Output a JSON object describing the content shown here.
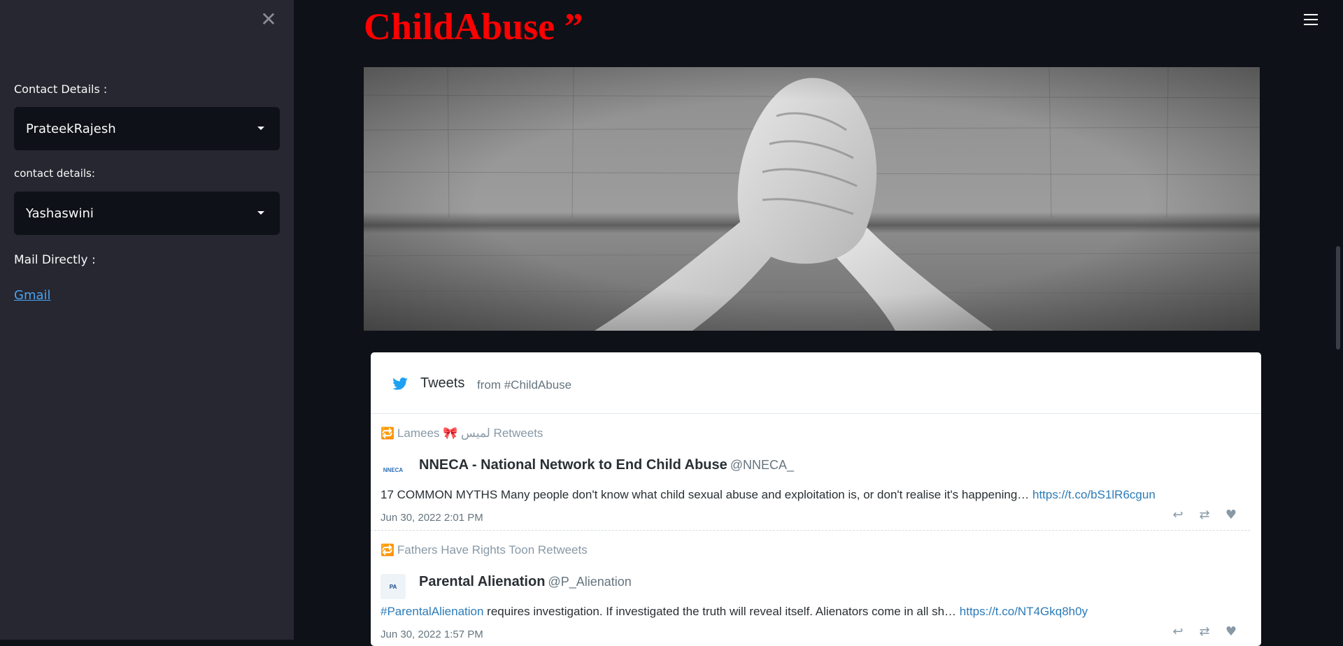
{
  "sidebar": {
    "close_icon": "close-icon",
    "contact_label": "Contact Details :",
    "contact_select_value": "PrateekRajesh",
    "contact2_label": "contact details:",
    "contact2_select_value": "Yashaswini",
    "mail_label": "Mail Directly :",
    "gmail_link": "Gmail"
  },
  "main": {
    "title": "ChildAbuse ”",
    "menu_icon": "hamburger-menu-icon",
    "hero_image": "clasped-hands-photo"
  },
  "tweets_widget": {
    "title": "Tweets",
    "subtitle": "from #ChildAbuse",
    "items": [
      {
        "retweet_line": "Lamees 🎀 لميس Retweets",
        "avatar_text": "NNECA",
        "name": "NNECA - National Network to End Child Abuse",
        "handle": "@NNECA_",
        "text": "17 COMMON MYTHS Many people don't know what child sexual abuse and exploitation is, or don't realise it's happening… ",
        "link": "https://t.co/bS1lR6cgun",
        "time": "Jun 30, 2022 2:01 PM"
      },
      {
        "retweet_line": "Fathers Have Rights Toon Retweets",
        "avatar_text": "PA",
        "name": "Parental Alienation",
        "handle": "@P_Alienation",
        "hashtag": "#ParentalAlienation",
        "text": " requires investigation. If investigated the truth will reveal itself. Alienators come in all sh… ",
        "link": "https://t.co/NT4Gkq8h0y",
        "time": "Jun 30, 2022 1:57 PM"
      }
    ]
  },
  "colors": {
    "background": "#0e1117",
    "sidebar": "#262730",
    "title_red": "#ff0000",
    "link_blue": "#4aa3f0",
    "twitter_blue": "#1da1f2"
  }
}
